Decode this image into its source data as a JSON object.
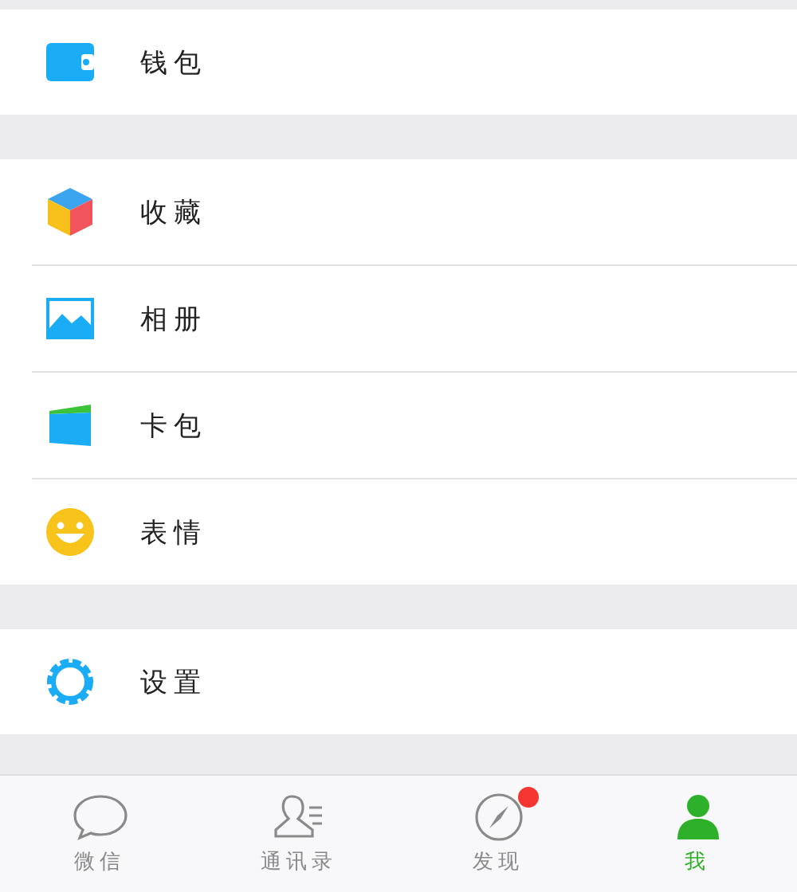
{
  "groups": [
    {
      "items": [
        {
          "kind": "wallet",
          "label": "钱包"
        }
      ]
    },
    {
      "items": [
        {
          "kind": "favorites",
          "label": "收藏"
        },
        {
          "kind": "album",
          "label": "相册"
        },
        {
          "kind": "cards",
          "label": "卡包"
        },
        {
          "kind": "stickers",
          "label": "表情"
        }
      ]
    },
    {
      "items": [
        {
          "kind": "settings",
          "label": "设置"
        }
      ]
    }
  ],
  "tabs": [
    {
      "kind": "chats",
      "label": "微信",
      "selected": false,
      "badge": false
    },
    {
      "kind": "contacts",
      "label": "通讯录",
      "selected": false,
      "badge": false
    },
    {
      "kind": "discover",
      "label": "发现",
      "selected": false,
      "badge": true
    },
    {
      "kind": "me",
      "label": "我",
      "selected": true,
      "badge": false
    }
  ]
}
